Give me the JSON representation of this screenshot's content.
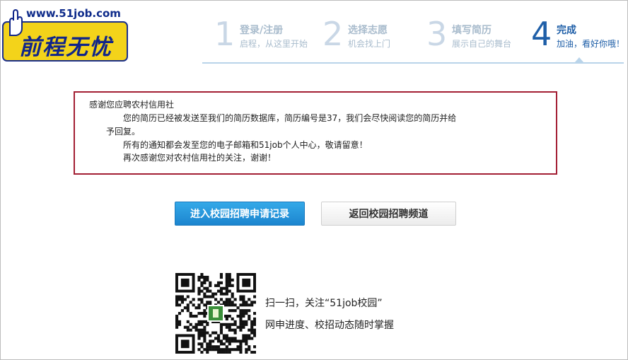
{
  "logo": {
    "url_text": "www.51job.com",
    "brand_text": "前程无忧"
  },
  "steps": [
    {
      "number": "1",
      "title": "登录/注册",
      "subtitle": "启程，从这里开始"
    },
    {
      "number": "2",
      "title": "选择志愿",
      "subtitle": "机会找上门"
    },
    {
      "number": "3",
      "title": "填写简历",
      "subtitle": "展示自己的舞台"
    },
    {
      "number": "4",
      "title": "完成",
      "subtitle": "加油，看好你哦！"
    }
  ],
  "active_step": "4",
  "message": {
    "greeting": "感谢您应聘农村信用社",
    "line1": "您的简历已经被发送至我们的简历数据库，简历编号是37，我们会尽快阅读您的简历并给",
    "line1_cont": "予回复。",
    "line2": "所有的通知都会发至您的电子邮箱和51job个人中心，敬请留意！",
    "line3": "再次感谢您对农村信用社的关注，谢谢！"
  },
  "buttons": {
    "primary_label": "进入校园招聘申请记录",
    "secondary_label": "返回校园招聘频道"
  },
  "qr": {
    "caption1": "扫一扫，关注“51job校园”",
    "caption2": "网申进度、校招动态随时掌握"
  },
  "colors": {
    "primary_blue": "#1c85cf",
    "box_border": "#a31f34",
    "logo_yellow": "#f3d31a",
    "logo_blue": "#10258a",
    "step_active": "#1f5fa8"
  }
}
